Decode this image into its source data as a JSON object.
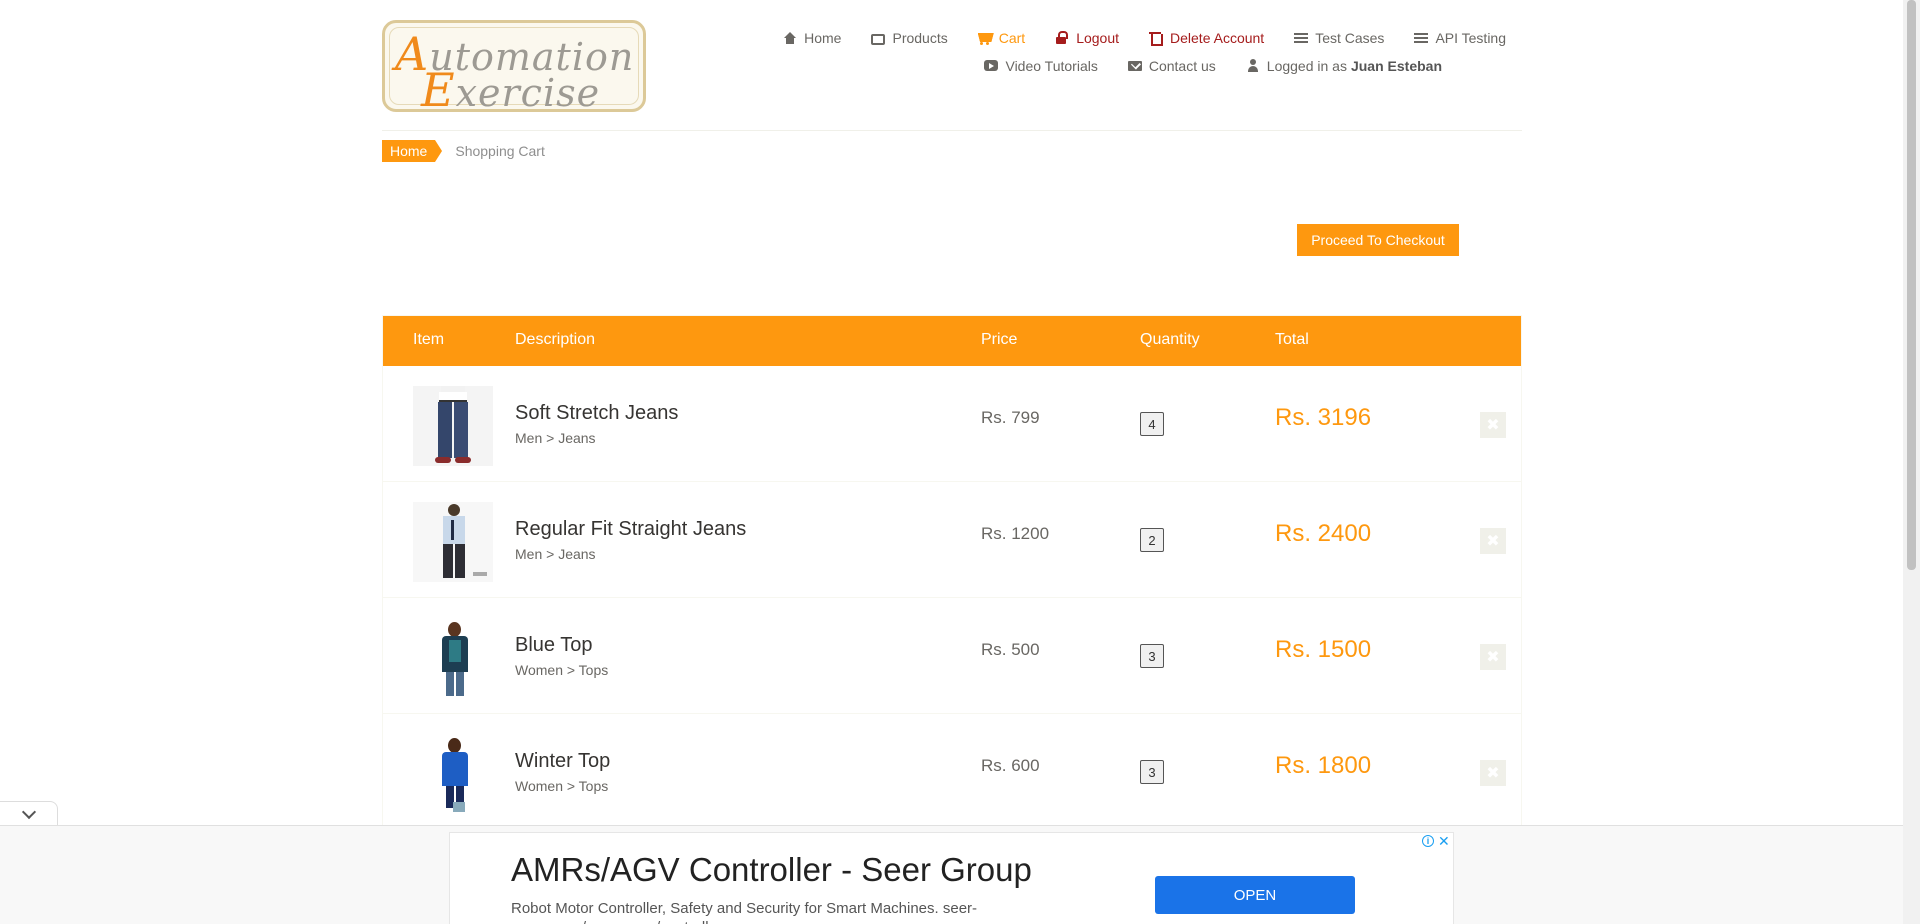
{
  "brand": {
    "line1_cap": "A",
    "line1_rest": "utomation",
    "line2_cap": "E",
    "line2_rest": "xercise",
    "accent": "#fe980f"
  },
  "nav": {
    "home": "Home",
    "products": "Products",
    "cart": "Cart",
    "logout": "Logout",
    "delete_account": "Delete Account",
    "test_cases": "Test Cases",
    "api_testing": "API Testing",
    "video_tutorials": "Video Tutorials",
    "contact_us": "Contact us",
    "logged_in_prefix": "Logged in as",
    "username": "Juan Esteban"
  },
  "breadcrumb": {
    "home": "Home",
    "current": "Shopping Cart"
  },
  "checkout_button": "Proceed To Checkout",
  "cart": {
    "headers": {
      "item": "Item",
      "description": "Description",
      "price": "Price",
      "quantity": "Quantity",
      "total": "Total"
    },
    "items": [
      {
        "name": "Soft Stretch Jeans",
        "category": "Men > Jeans",
        "price": "Rs. 799",
        "quantity": "4",
        "total": "Rs. 3196"
      },
      {
        "name": "Regular Fit Straight Jeans",
        "category": "Men > Jeans",
        "price": "Rs. 1200",
        "quantity": "2",
        "total": "Rs. 2400"
      },
      {
        "name": "Blue Top",
        "category": "Women > Tops",
        "price": "Rs. 500",
        "quantity": "3",
        "total": "Rs. 1500"
      },
      {
        "name": "Winter Top",
        "category": "Women > Tops",
        "price": "Rs. 600",
        "quantity": "3",
        "total": "Rs. 1800"
      }
    ]
  },
  "ad": {
    "title": "AMRs/AGV Controller - Seer Group",
    "description": "Robot Motor Controller, Safety and Security for Smart Machines. seer-group.com/amrs-agvs/controller",
    "open_button": "OPEN",
    "info": "i",
    "close": "✕"
  }
}
